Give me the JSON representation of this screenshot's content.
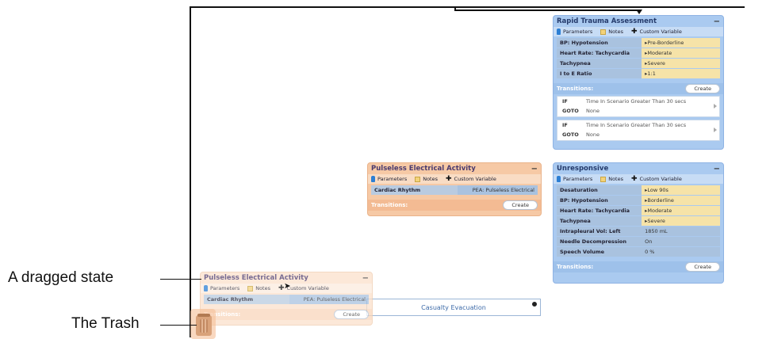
{
  "states": {
    "rapid": {
      "title": "Rapid Trauma Assessment",
      "collapse": "−",
      "toolbar": {
        "parameters": "Parameters",
        "notes": "Notes",
        "custom": "Custom Variable"
      },
      "params": [
        {
          "name": "BP: Hypotension",
          "value": "Pre-Borderline"
        },
        {
          "name": "Heart Rate: Tachycardia",
          "value": "Moderate"
        },
        {
          "name": "Tachypnea",
          "value": "Severe"
        },
        {
          "name": "I to E Ratio",
          "value": "1:1"
        }
      ],
      "transitions_label": "Transitions:",
      "create": "Create",
      "transitions": [
        {
          "if_k": "IF",
          "if_v": "Time In Scenario Greater Than 30 secs",
          "goto_k": "GOTO",
          "goto_v": "None"
        },
        {
          "if_k": "IF",
          "if_v": "Time In Scenario Greater Than 30 secs",
          "goto_k": "GOTO",
          "goto_v": "None"
        }
      ]
    },
    "pea": {
      "title": "Pulseless Electrical Activity",
      "collapse": "−",
      "toolbar": {
        "parameters": "Parameters",
        "notes": "Notes",
        "custom": "Custom Variable"
      },
      "params": [
        {
          "name": "Cardiac Rhythm",
          "value": "PEA: Pulseless Electrical"
        }
      ],
      "transitions_label": "Transitions:",
      "create": "Create"
    },
    "unresponsive": {
      "title": "Unresponsive",
      "collapse": "−",
      "toolbar": {
        "parameters": "Parameters",
        "notes": "Notes",
        "custom": "Custom Variable"
      },
      "params": [
        {
          "name": "Desaturation",
          "value": "Low 90s"
        },
        {
          "name": "BP: Hypotension",
          "value": "Borderline"
        },
        {
          "name": "Heart Rate: Tachycardia",
          "value": "Moderate"
        },
        {
          "name": "Tachypnea",
          "value": "Severe"
        },
        {
          "name": "Intrapleural Vol: Left",
          "value": "1850 mL"
        },
        {
          "name": "Needle Decompression",
          "value": "On"
        },
        {
          "name": "Speech Volume",
          "value": "0 %"
        }
      ],
      "transitions_label": "Transitions:",
      "create": "Create"
    },
    "dragged": {
      "title": "Pulseless Electrical Activity",
      "collapse": "−",
      "toolbar": {
        "parameters": "Parameters",
        "notes": "Notes",
        "custom": "Custom Variable"
      },
      "params": [
        {
          "name": "Cardiac Rhythm",
          "value": "PEA: Pulseless Electrical"
        }
      ],
      "transitions_label": "Transitions:",
      "create": "Create"
    }
  },
  "casualty": {
    "label": "Casualty Evacuation"
  },
  "callouts": {
    "dragged": "A dragged state",
    "trash": "The Trash"
  }
}
